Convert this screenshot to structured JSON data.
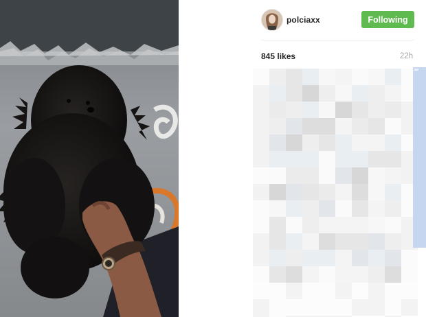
{
  "post": {
    "username": "polciaxx",
    "follow_label": "Following",
    "likes": "845 likes",
    "time_ago": "22h"
  },
  "icons": {
    "avatar": "profile-avatar",
    "photo": "black-pomeranian-dog-photo"
  },
  "colors": {
    "follow_button": "#5fbb50",
    "text_primary": "#262626",
    "text_muted": "#a5a7aa",
    "scrollbar": "#c6d5f0"
  }
}
